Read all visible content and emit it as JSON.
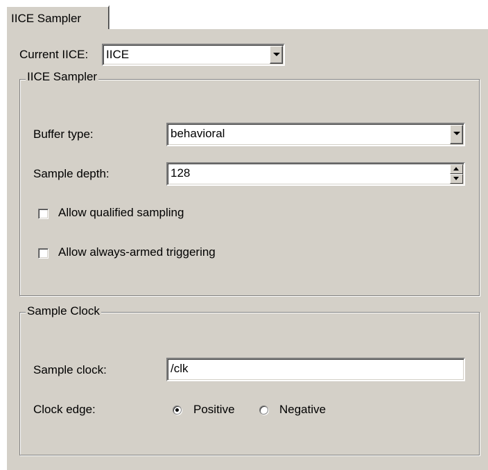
{
  "tab": {
    "label": "IICE Sampler"
  },
  "current_iice": {
    "label": "Current IICE:",
    "value": "IICE"
  },
  "sampler_group": {
    "title": "IICE Sampler",
    "buffer_type": {
      "label": "Buffer type:",
      "value": "behavioral"
    },
    "sample_depth": {
      "label": "Sample depth:",
      "value": "128"
    },
    "allow_qualified": {
      "label": "Allow qualified sampling",
      "checked": false
    },
    "allow_always_armed": {
      "label": "Allow always-armed triggering",
      "checked": false
    }
  },
  "clock_group": {
    "title": "Sample Clock",
    "sample_clock": {
      "label": "Sample clock:",
      "value": "/clk"
    },
    "clock_edge": {
      "label": "Clock edge:",
      "options": [
        {
          "label": "Positive",
          "selected": true
        },
        {
          "label": "Negative",
          "selected": false
        }
      ]
    }
  }
}
